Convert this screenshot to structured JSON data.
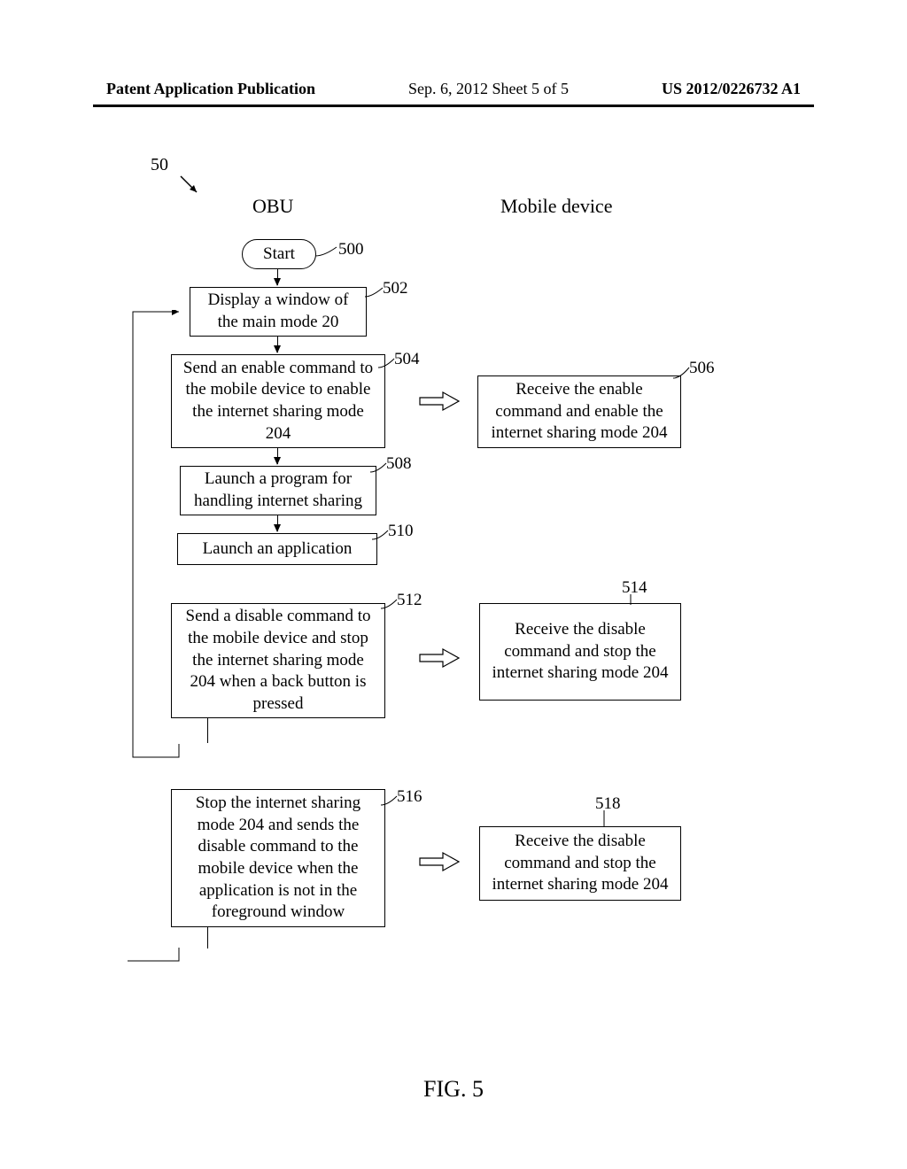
{
  "header": {
    "left": "Patent Application Publication",
    "center": "Sep. 6, 2012  Sheet 5 of 5",
    "right": "US 2012/0226732 A1"
  },
  "refs": {
    "r50": "50",
    "r500": "500",
    "r502": "502",
    "r504": "504",
    "r506": "506",
    "r508": "508",
    "r510": "510",
    "r512": "512",
    "r514": "514",
    "r516": "516",
    "r518": "518"
  },
  "labels": {
    "obu": "OBU",
    "mobile": "Mobile device",
    "start": "Start",
    "figure": "FIG. 5"
  },
  "boxes": {
    "b502": "Display a window of the main mode 20",
    "b504": "Send an enable command to the mobile device to enable the internet sharing mode 204",
    "b506": "Receive the enable command and enable the internet sharing mode 204",
    "b508": "Launch a program for handling internet sharing",
    "b510": "Launch an application",
    "b512": "Send a disable command to the mobile device and stop the internet sharing mode 204 when a back button is pressed",
    "b514": "Receive the disable command and stop the internet sharing mode 204",
    "b516": "Stop the internet sharing mode 204 and sends the disable command to the mobile device when the application is not in the foreground window",
    "b518": "Receive the disable command and stop the internet sharing mode 204"
  }
}
